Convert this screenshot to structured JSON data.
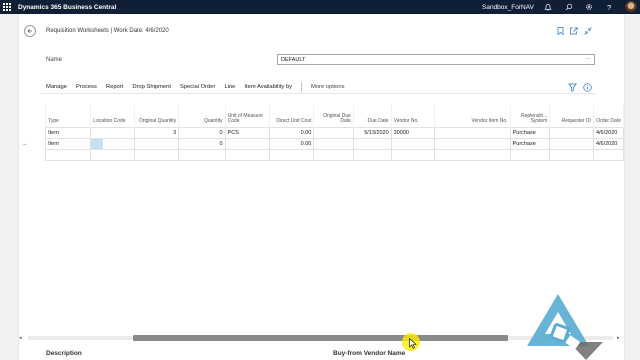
{
  "app": {
    "name": "Dynamics 365 Business Central",
    "environment": "Sandbox_ForNAV",
    "top_icons": [
      "bell-icon",
      "search-icon",
      "gear-icon",
      "help-icon"
    ],
    "header_color": "#0f1f35"
  },
  "page": {
    "title": "Requisition Worksheets | Work Date: 4/6/2020",
    "header_icons": [
      "bookmark-icon",
      "open-new-window-icon",
      "collapse-icon"
    ]
  },
  "name_field": {
    "label": "Name",
    "value": "DEFAULT",
    "lookup": "···"
  },
  "actions": {
    "items": [
      "Manage",
      "Process",
      "Report",
      "Drop Shipment",
      "Special Order",
      "Line",
      "Item Availability by"
    ],
    "more": "More options"
  },
  "grid": {
    "columns": [
      "Type",
      "Location Code",
      "Original Quantity",
      "Quantity",
      "Unit of Measure Code",
      "Direct Unit Cost",
      "Original Due Date",
      "Due Date",
      "Vendor No.",
      "Vendor Item No.",
      "Replenish... System",
      "Requester ID",
      "Order Date"
    ],
    "rows": [
      {
        "marker": "",
        "cells": [
          "Item",
          "",
          "3",
          "0",
          "PCS",
          "0.00",
          "",
          "5/13/2020",
          "30000",
          "",
          "Purchase",
          "",
          "4/6/2020"
        ]
      },
      {
        "marker": "→",
        "cells": [
          "Item",
          "",
          "",
          "0",
          "",
          "0.00",
          "",
          "",
          "",
          "",
          "Purchase",
          "",
          "4/6/2020"
        ]
      },
      {
        "marker": "",
        "cells": [
          "",
          "",
          "",
          "",
          "",
          "",
          "",
          "",
          "",
          "",
          "",
          "",
          ""
        ]
      }
    ]
  },
  "bottom": {
    "description_label": "Description",
    "vendor_name_label": "Buy-from Vendor Name"
  },
  "colors": {
    "accent": "#1e70c2",
    "selected_cell": "#c3e1f3",
    "watermark": "#5aaed2"
  }
}
